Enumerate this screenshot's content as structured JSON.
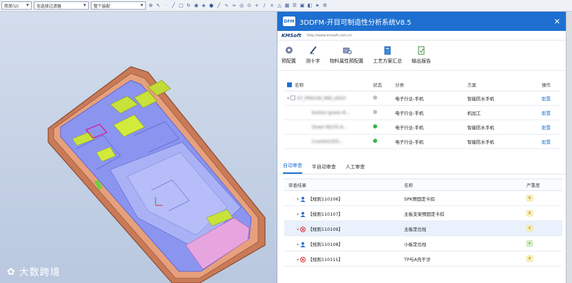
{
  "cad_toolbar": {
    "view_select": "简单(U)",
    "filter_select": "无选择过滤器",
    "scope_select": "整个装配"
  },
  "watermark": {
    "text": "大数跨境"
  },
  "panel": {
    "logo": "DFM",
    "title": "3DDFM-开目可制造性分析系统V8.5",
    "brand": "KMSoft",
    "brand_url": "http://www.kmsoft.com.cn",
    "tools": [
      {
        "label": "预配置",
        "icon": "gear-icon"
      },
      {
        "label": "测十字",
        "icon": "measure-icon"
      },
      {
        "label": "物料属性预配置",
        "icon": "material-icon"
      },
      {
        "label": "工艺方案汇总",
        "icon": "book-icon"
      },
      {
        "label": "输出报告",
        "icon": "report-icon"
      }
    ]
  },
  "parts_table": {
    "headers": {
      "name": "名称",
      "status": "状态",
      "category": "分类",
      "scheme": "方案",
      "action": "操作"
    },
    "rows": [
      {
        "name": "ST_PM01W_MID_ASSY",
        "status_color": "#bdbdbd",
        "category": "电子行业-手机",
        "scheme": "智能防水手机",
        "action": "配置"
      },
      {
        "name": "button-green-R...",
        "status_color": "#bdbdbd",
        "category": "电子行业-手机",
        "scheme": "机加工",
        "action": "配置"
      },
      {
        "name": "Down-NG7E-A...",
        "status_color": "#3cb44a",
        "category": "电子行业-手机",
        "scheme": "智能防水手机",
        "action": "配置"
      },
      {
        "name": "Crank02355...",
        "status_color": "#3cb44a",
        "category": "电子行业-手机",
        "scheme": "智能防水手机",
        "action": "配置"
      }
    ]
  },
  "review_tabs": [
    {
      "label": "自动审查",
      "active": true
    },
    {
      "label": "半自动审查",
      "active": false
    },
    {
      "label": "人工审查",
      "active": false
    }
  ],
  "rule_table": {
    "headers": {
      "result": "审查结果",
      "name": "名称",
      "severity": "严重度"
    },
    "rows": [
      {
        "rule": "【规则110106】",
        "icon": "user-icon",
        "name": "SPK预固定卡扣",
        "severity": "B"
      },
      {
        "rule": "【规则110107】",
        "icon": "user-icon",
        "name": "主板支架预固定卡扣",
        "severity": "B"
      },
      {
        "rule": "【规则110109】",
        "icon": "error-icon",
        "name": "主板定位柱",
        "severity": "B"
      },
      {
        "rule": "【规则110108】",
        "icon": "user-icon",
        "name": "小板定位柱",
        "severity": "A"
      },
      {
        "rule": "【规则110111】",
        "icon": "error-icon",
        "name": "TP与A壳干涉",
        "severity": "B"
      }
    ]
  }
}
